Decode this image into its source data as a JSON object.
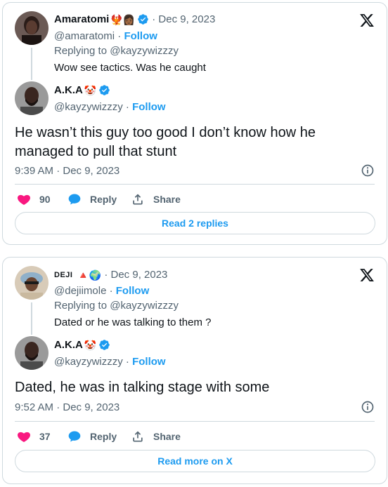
{
  "tweets": [
    {
      "quoted": {
        "display_name": "Amaratomi",
        "emojis": "🐦‍🔥👩🏾",
        "date": "· Dec 9, 2023",
        "handle": "@amaratomi",
        "follow": "Follow",
        "replying_to": "Replying to @kayzywizzzy",
        "text": "Wow see tactics. Was he caught"
      },
      "reply": {
        "display_name": "A.K.A",
        "emojis": "🤡",
        "handle": "@kayzywizzzy",
        "separator": " · ",
        "follow": "Follow",
        "text": "He wasn’t this guy too good I don’t know how he managed to pull that stunt",
        "timestamp": "9:39 AM · Dec 9, 2023"
      },
      "actions": {
        "likes": "90",
        "reply": "Reply",
        "share": "Share"
      },
      "button_label": "Read 2 replies"
    },
    {
      "quoted": {
        "display_name": "DEJI",
        "emojis": "🔺🌍",
        "date": "· Dec 9, 2023",
        "handle": "@dejiimole",
        "follow": "Follow",
        "replying_to": "Replying to @kayzywizzzy",
        "text": "Dated or he was talking to them ?"
      },
      "reply": {
        "display_name": "A.K.A",
        "emojis": "🤡",
        "handle": "@kayzywizzzy",
        "separator": " · ",
        "follow": "Follow",
        "text": "Dated, he was in talking stage with some",
        "timestamp": "9:52 AM · Dec 9, 2023"
      },
      "actions": {
        "likes": "37",
        "reply": "Reply",
        "share": "Share"
      },
      "button_label": "Read more on X"
    }
  ],
  "icons": {
    "like": "heart-icon",
    "reply": "speech-bubble-icon",
    "share": "share-upload-icon",
    "info": "info-icon",
    "verified": "verified-badge-icon",
    "logo": "x-logo-icon"
  },
  "colors": {
    "accent": "#1d9bf0",
    "like": "#f91880",
    "muted": "#536471",
    "border": "#cfd9de",
    "text": "#0f1419"
  }
}
